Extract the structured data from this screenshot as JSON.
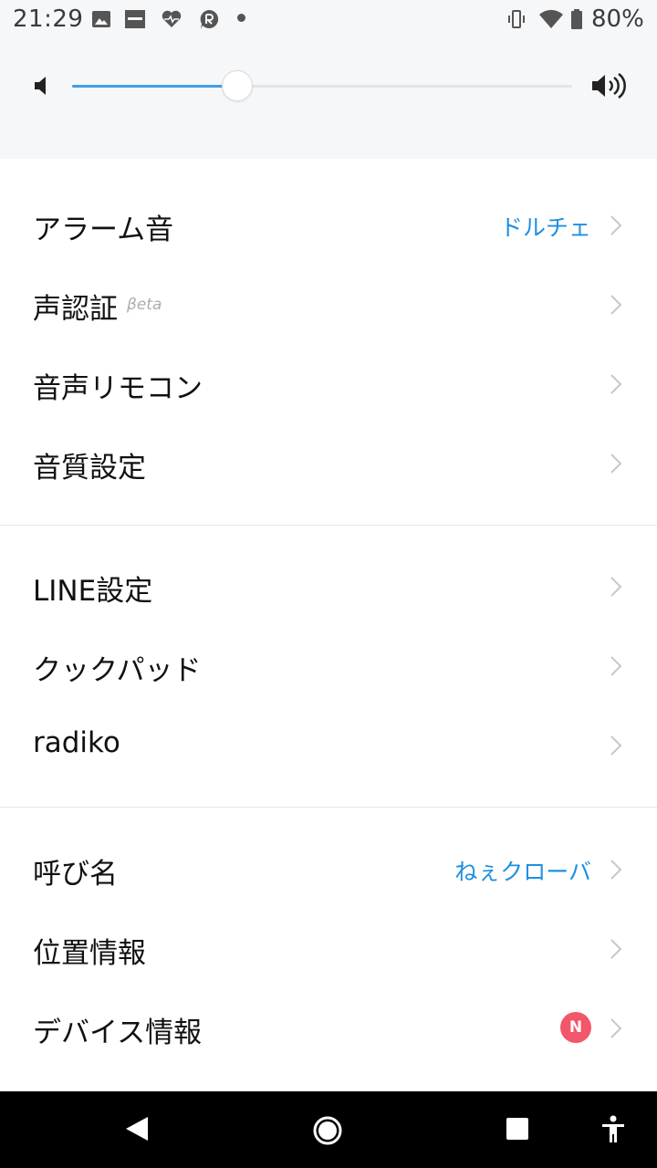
{
  "status_bar": {
    "time": "21:29",
    "battery_percent": "80%",
    "icons": [
      "image-icon",
      "ifttt-icon",
      "heart-pulse-icon",
      "r-app-icon",
      "dot-icon",
      "vibrate-icon",
      "wifi-icon",
      "battery-icon"
    ]
  },
  "volume": {
    "level": 0.33,
    "accent_color": "#3d9ee6",
    "icons": [
      "volume-low-icon",
      "volume-high-icon"
    ]
  },
  "settings": {
    "group1": [
      {
        "label": "アラーム音",
        "value": "ドルチェ"
      },
      {
        "label": "声認証",
        "tag": "βeta"
      },
      {
        "label": "音声リモコン"
      },
      {
        "label": "音質設定"
      }
    ],
    "group2": [
      {
        "label": "LINE設定"
      },
      {
        "label": "クックパッド"
      },
      {
        "label": "radiko"
      }
    ],
    "group3": [
      {
        "label": "呼び名",
        "value": "ねぇクローバ"
      },
      {
        "label": "位置情報"
      },
      {
        "label": "デバイス情報",
        "badge": "N"
      }
    ]
  },
  "colors": {
    "value_text": "#1f8fe0",
    "badge": "#f2566a",
    "header_bg": "#f6f7f9"
  },
  "nav_bar": {
    "icons": [
      "back-icon",
      "home-icon",
      "recents-icon",
      "accessibility-icon"
    ]
  }
}
